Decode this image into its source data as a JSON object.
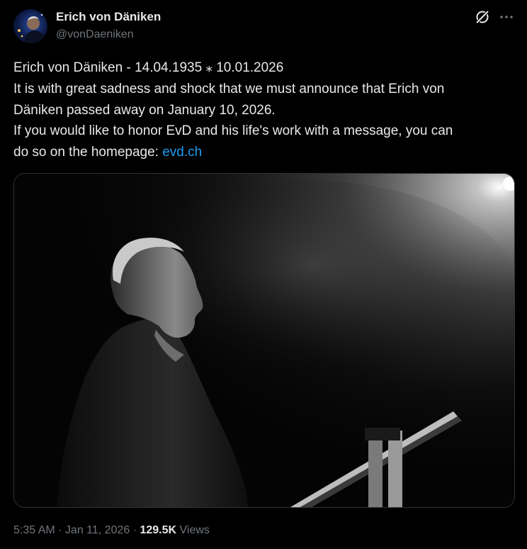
{
  "author": {
    "display_name": "Erich von Däniken",
    "handle": "@vonDaeniken"
  },
  "tweet": {
    "line1": "Erich von Däniken - 14.04.1935 ⁎ 10.01.2026",
    "line2": "It is with great sadness and shock that we must announce that Erich von",
    "line3": "Däniken passed away on January 10, 2026.",
    "line4": "If you would like to honor EvD and his life's work with a message, you can",
    "line5_prefix": "do so on the homepage: ",
    "link_text": "evd.ch"
  },
  "meta": {
    "time": "5:35 AM",
    "sep": " · ",
    "date": "Jan 11, 2026",
    "views_count": "129.5K",
    "views_label": " Views"
  },
  "icons": {
    "avatar": "avatar-photo",
    "grok": "grok-icon",
    "more": "more-dots-icon",
    "media": "black-and-white-photo-speaker-at-lectern"
  },
  "colors": {
    "background": "#000000",
    "text": "#e7e9ea",
    "secondary": "#71767b",
    "link": "#1d9bf0",
    "border": "#2f3336"
  }
}
